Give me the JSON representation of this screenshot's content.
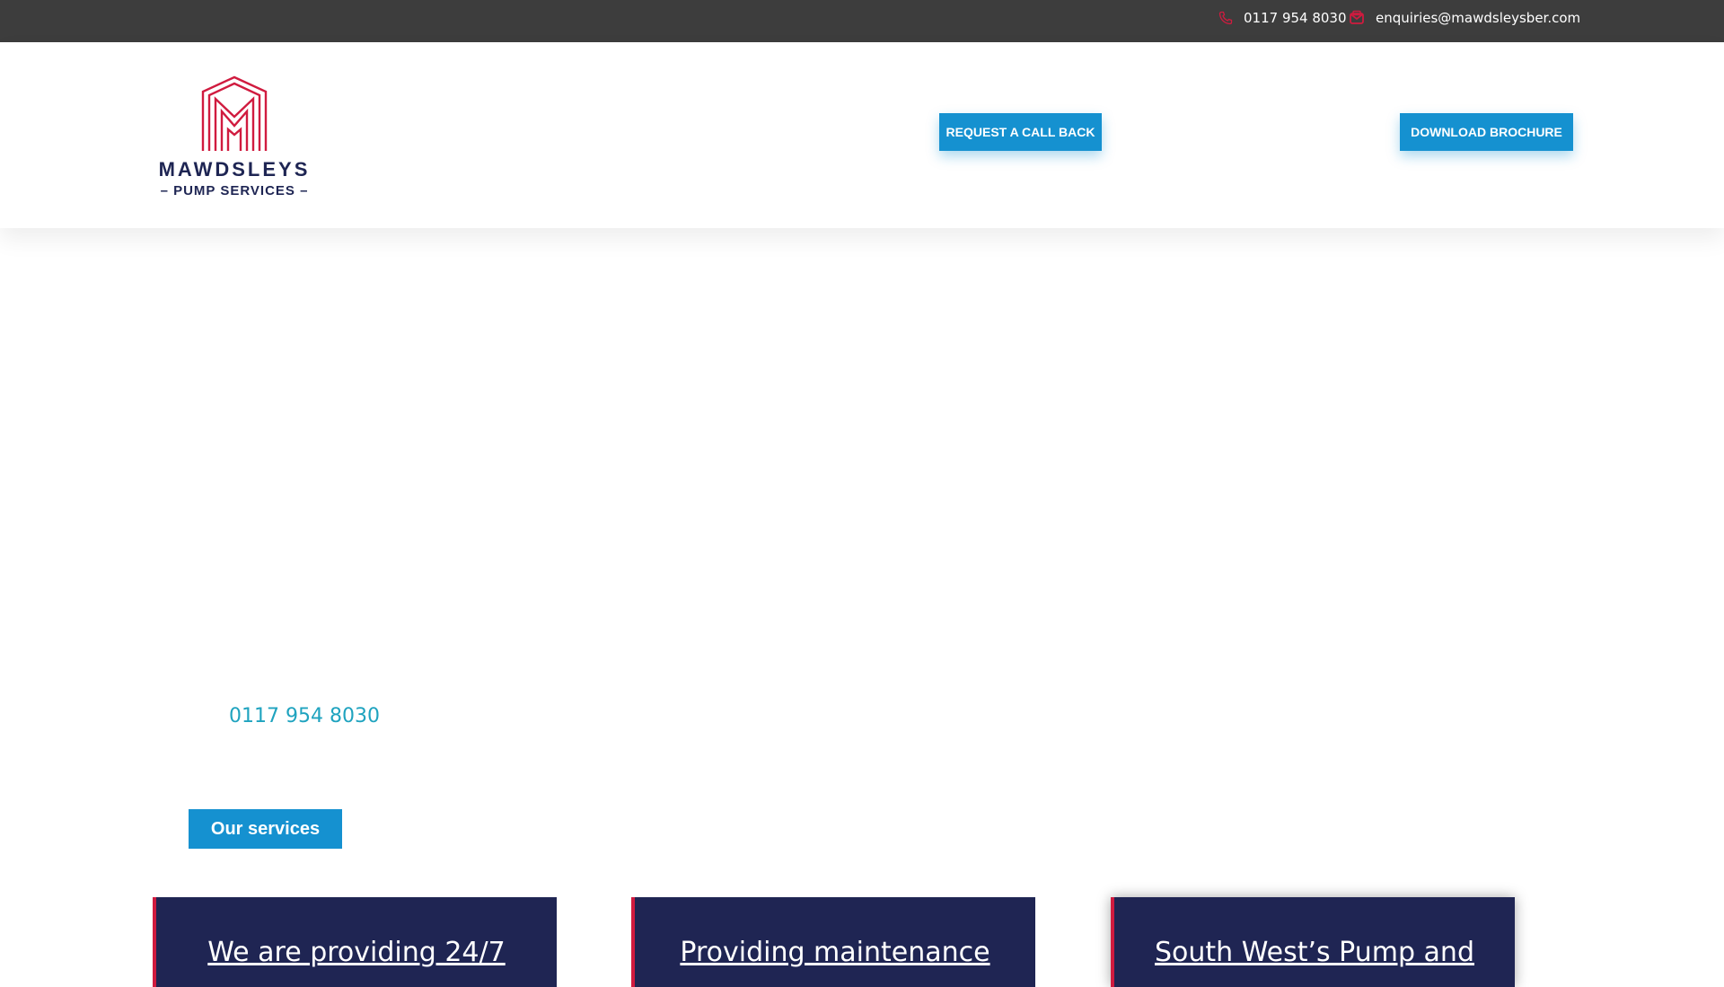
{
  "topbar": {
    "phone": "0117 954 8030",
    "email": "enquiries@mawdsleysber.com"
  },
  "header": {
    "logo": {
      "brand": "MAWDSLEYS",
      "sub": "– PUMP SERVICES –"
    },
    "request_callback_label": "REQUEST A CALL BACK",
    "download_brochure_label": "DOWNLOAD BROCHURE"
  },
  "hero": {
    "phone": "0117 954 8030",
    "services_label": "Our services"
  },
  "cards": [
    {
      "title": "We are providing 24/7"
    },
    {
      "title": "Providing maintenance"
    },
    {
      "title": "South West’s Pump and"
    }
  ],
  "colors": {
    "topbar_bg": "#3d3d3d",
    "accent_blue": "#1591d0",
    "brand_red": "#d01b3f",
    "navy": "#1f2553",
    "teal_text": "#1fa3bf"
  }
}
